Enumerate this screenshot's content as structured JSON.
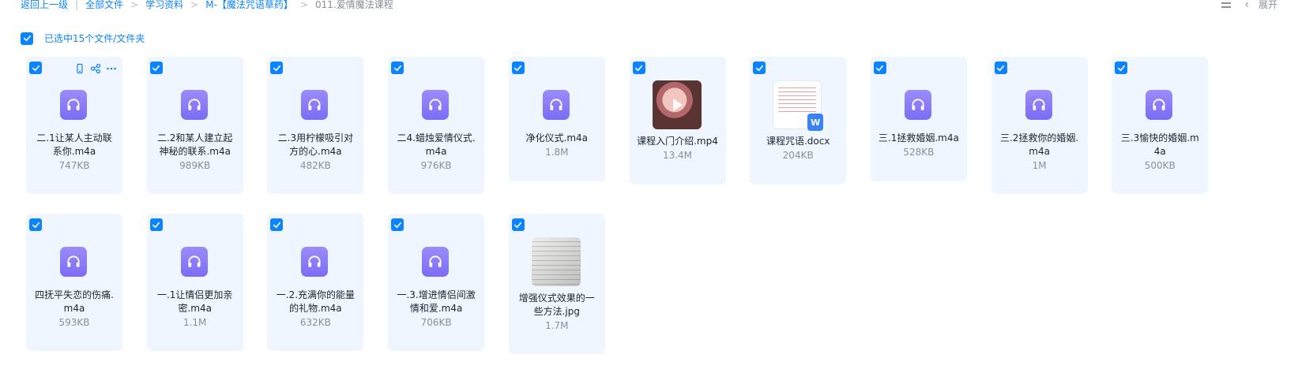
{
  "breadcrumb": {
    "back": "返回上一级",
    "all_files": "全部文件",
    "study": "学习资料",
    "folder": "M-【魔法咒语草药】",
    "current": "011.爱情魔法课程",
    "sep_bar": "|",
    "sep_arrow": ">"
  },
  "toolbar": {
    "expand": "展开",
    "collapse_chevron": "‹"
  },
  "selection": {
    "label": "已选中15个文件/文件夹"
  },
  "colors": {
    "accent": "#0d84ff",
    "card_bg": "#f0f6ff",
    "audio_icon": "#8a7cf8"
  },
  "files": [
    {
      "name": "二.1让某人主动联系你.m4a",
      "size": "747KB",
      "type": "audio-icon",
      "checked": true
    },
    {
      "name": "二.2和某人建立起神秘的联系.m4a",
      "size": "989KB",
      "type": "audio-icon",
      "checked": true
    },
    {
      "name": "二.3用柠檬吸引对方的心.m4a",
      "size": "482KB",
      "type": "audio-icon",
      "checked": true
    },
    {
      "name": "二4.蜡烛爱情仪式.m4a",
      "size": "976KB",
      "type": "audio-icon",
      "checked": true
    },
    {
      "name": "净化仪式.m4a",
      "size": "1.8M",
      "type": "audio-icon",
      "checked": true
    },
    {
      "name": "课程入门介绍.mp4",
      "size": "13.4M",
      "type": "video-thumbnail",
      "checked": true
    },
    {
      "name": "课程咒语.docx",
      "size": "204KB",
      "type": "word-doc-thumbnail",
      "checked": true
    },
    {
      "name": "三.1拯救婚姻.m4a",
      "size": "528KB",
      "type": "audio-icon",
      "checked": true
    },
    {
      "name": "三.2拯救你的婚姻.m4a",
      "size": "1M",
      "type": "audio-icon",
      "checked": true
    },
    {
      "name": "三.3愉快的婚姻.m4a",
      "size": "500KB",
      "type": "audio-icon",
      "checked": true
    },
    {
      "name": "四抚平失恋的伤痛.m4a",
      "size": "593KB",
      "type": "audio-icon",
      "checked": true
    },
    {
      "name": "一.1让情侣更加亲密.m4a",
      "size": "1.1M",
      "type": "audio-icon",
      "checked": true
    },
    {
      "name": "一.2.充满你的能量的礼物.m4a",
      "size": "632KB",
      "type": "audio-icon",
      "checked": true
    },
    {
      "name": "一.3.增进情侣间激情和爱.m4a",
      "size": "706KB",
      "type": "audio-icon",
      "checked": true
    },
    {
      "name": "增强仪式效果的一些方法.jpg",
      "size": "1.7M",
      "type": "image-thumbnail",
      "checked": true
    }
  ],
  "file_lines": [
    [
      "二.1让某人主动联",
      "系你.m4a"
    ],
    [
      "二.2和某人建立起",
      "神秘的联系.m4a"
    ],
    [
      "二.3用柠檬吸引对",
      "方的心.m4a"
    ],
    [
      "二4.蜡烛爱情仪式.",
      "m4a"
    ],
    [
      "净化仪式.m4a"
    ],
    [
      "课程入门介绍.mp4"
    ],
    [
      "课程咒语.docx"
    ],
    [
      "三.1拯救婚姻.m4a"
    ],
    [
      "三.2拯救你的婚姻.",
      "m4a"
    ],
    [
      "三.3愉快的婚姻.m",
      "4a"
    ],
    [
      "四抚平失恋的伤痛.",
      "m4a"
    ],
    [
      "一.1让情侣更加亲",
      "密.m4a"
    ],
    [
      "一.2.充满你的能量",
      "的礼物.m4a"
    ],
    [
      "一.3.增进情侣间激",
      "情和爱.m4a"
    ],
    [
      "增强仪式效果的一",
      "些方法.jpg"
    ]
  ],
  "card_action_icons": [
    "phone-icon",
    "share-icon",
    "more-icon"
  ]
}
